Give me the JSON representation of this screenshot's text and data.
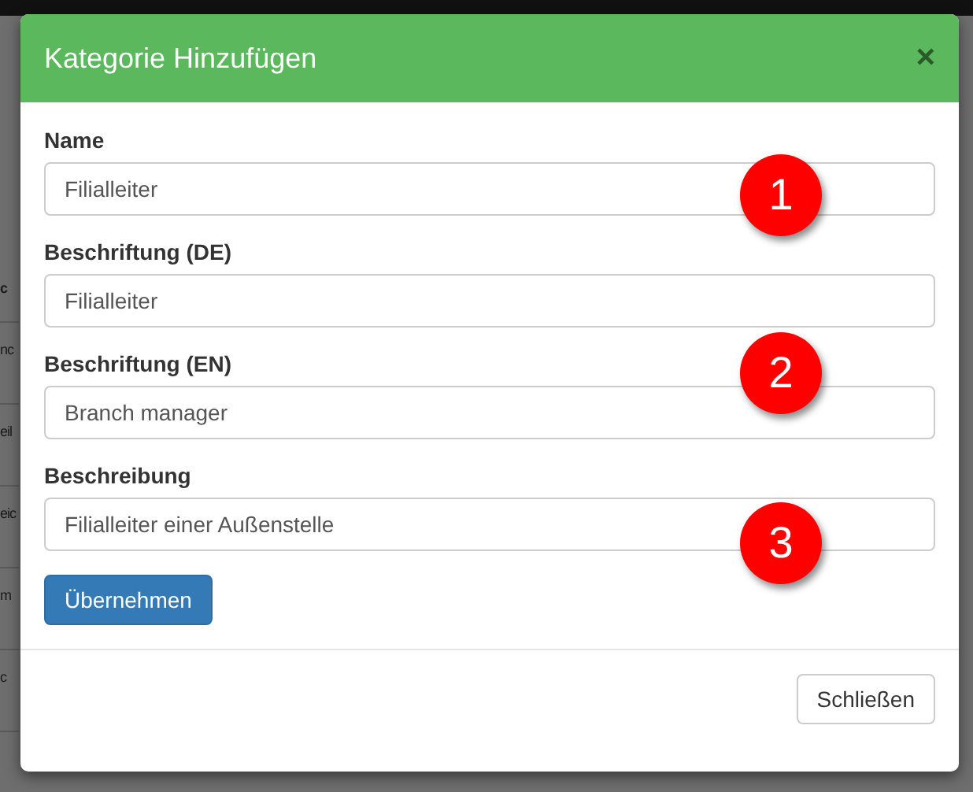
{
  "background": {
    "rows": [
      {
        "text": "c",
        "bold": true
      },
      {
        "text": "nc",
        "bold": false
      },
      {
        "text": "eil",
        "bold": false
      },
      {
        "text": "eic",
        "bold": false
      },
      {
        "text": "m",
        "bold": false
      },
      {
        "text": "c",
        "bold": false
      }
    ]
  },
  "modal": {
    "title": "Kategorie Hinzufügen",
    "close": "×",
    "fields": [
      {
        "label": "Name",
        "value": "Filialleiter"
      },
      {
        "label": "Beschriftung (DE)",
        "value": "Filialleiter"
      },
      {
        "label": "Beschriftung (EN)",
        "value": "Branch manager"
      },
      {
        "label": "Beschreibung",
        "value": "Filialleiter einer Außenstelle"
      }
    ],
    "submit": "Übernehmen",
    "dismiss": "Schließen"
  },
  "markers": [
    "1",
    "2",
    "3"
  ]
}
